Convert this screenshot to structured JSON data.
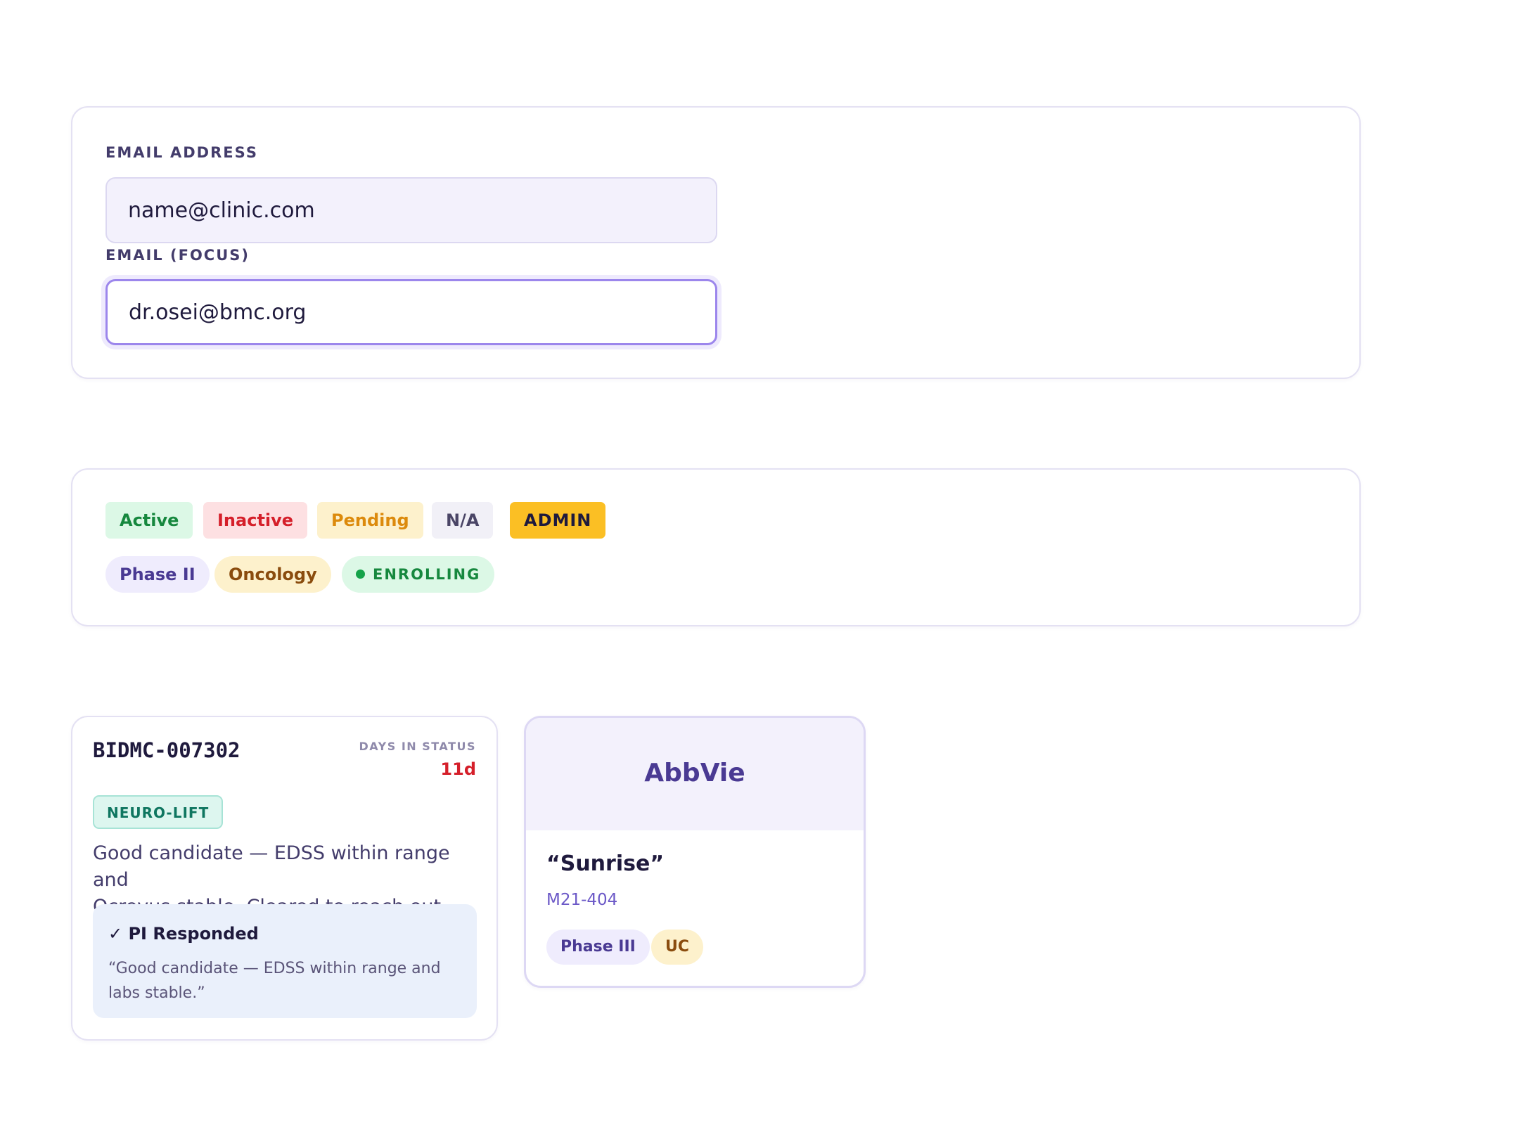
{
  "form": {
    "email_label": "EMAIL ADDRESS",
    "email_value": "name@clinic.com",
    "focus_label": "EMAIL (FOCUS)",
    "focus_value": "dr.osei@bmc.org"
  },
  "badges": {
    "status": [
      {
        "label": "Active",
        "bg": "#dcf8e6",
        "color": "#16883e"
      },
      {
        "label": "Inactive",
        "bg": "#fde0e2",
        "color": "#d51f2a"
      },
      {
        "label": "Pending",
        "bg": "#fdf1cc",
        "color": "#dc8a0c"
      },
      {
        "label": "N/A",
        "bg": "#f1f0f7",
        "color": "#4a4566"
      },
      {
        "label": "ADMIN",
        "bg": "#fbbf24",
        "color": "#1f1a3d"
      }
    ],
    "pills": [
      {
        "label": "Phase II",
        "bg": "#efecfd",
        "color": "#4a3a93"
      },
      {
        "label": "Oncology",
        "bg": "#fdf1cc",
        "color": "#8a4c0e"
      },
      {
        "label": "ENROLLING",
        "bg": "#dcf8e6",
        "color": "#16883e"
      }
    ]
  },
  "candidate": {
    "id": "BIDMC-007302",
    "days_label": "DAYS IN STATUS",
    "days_value": "11d",
    "tag": "NEURO-LIFT",
    "note_line1": "Good candidate — EDSS within range and",
    "note_line2": "Ocrevus stable. Cleared to reach out.",
    "response": {
      "check": "✓",
      "title": "PI Responded",
      "quote_line1": "“Good candidate — EDSS within range and",
      "quote_line2": "labs stable.”"
    }
  },
  "sponsor": {
    "name": "AbbVie",
    "study_name": "“Sunrise”",
    "study_code": "M21-404",
    "tags": [
      "Phase III",
      "UC"
    ]
  },
  "colors": {
    "brand_purple": "#4a3a93",
    "focus_ring": "#9c86ec",
    "alert_red": "#d51f2a"
  }
}
